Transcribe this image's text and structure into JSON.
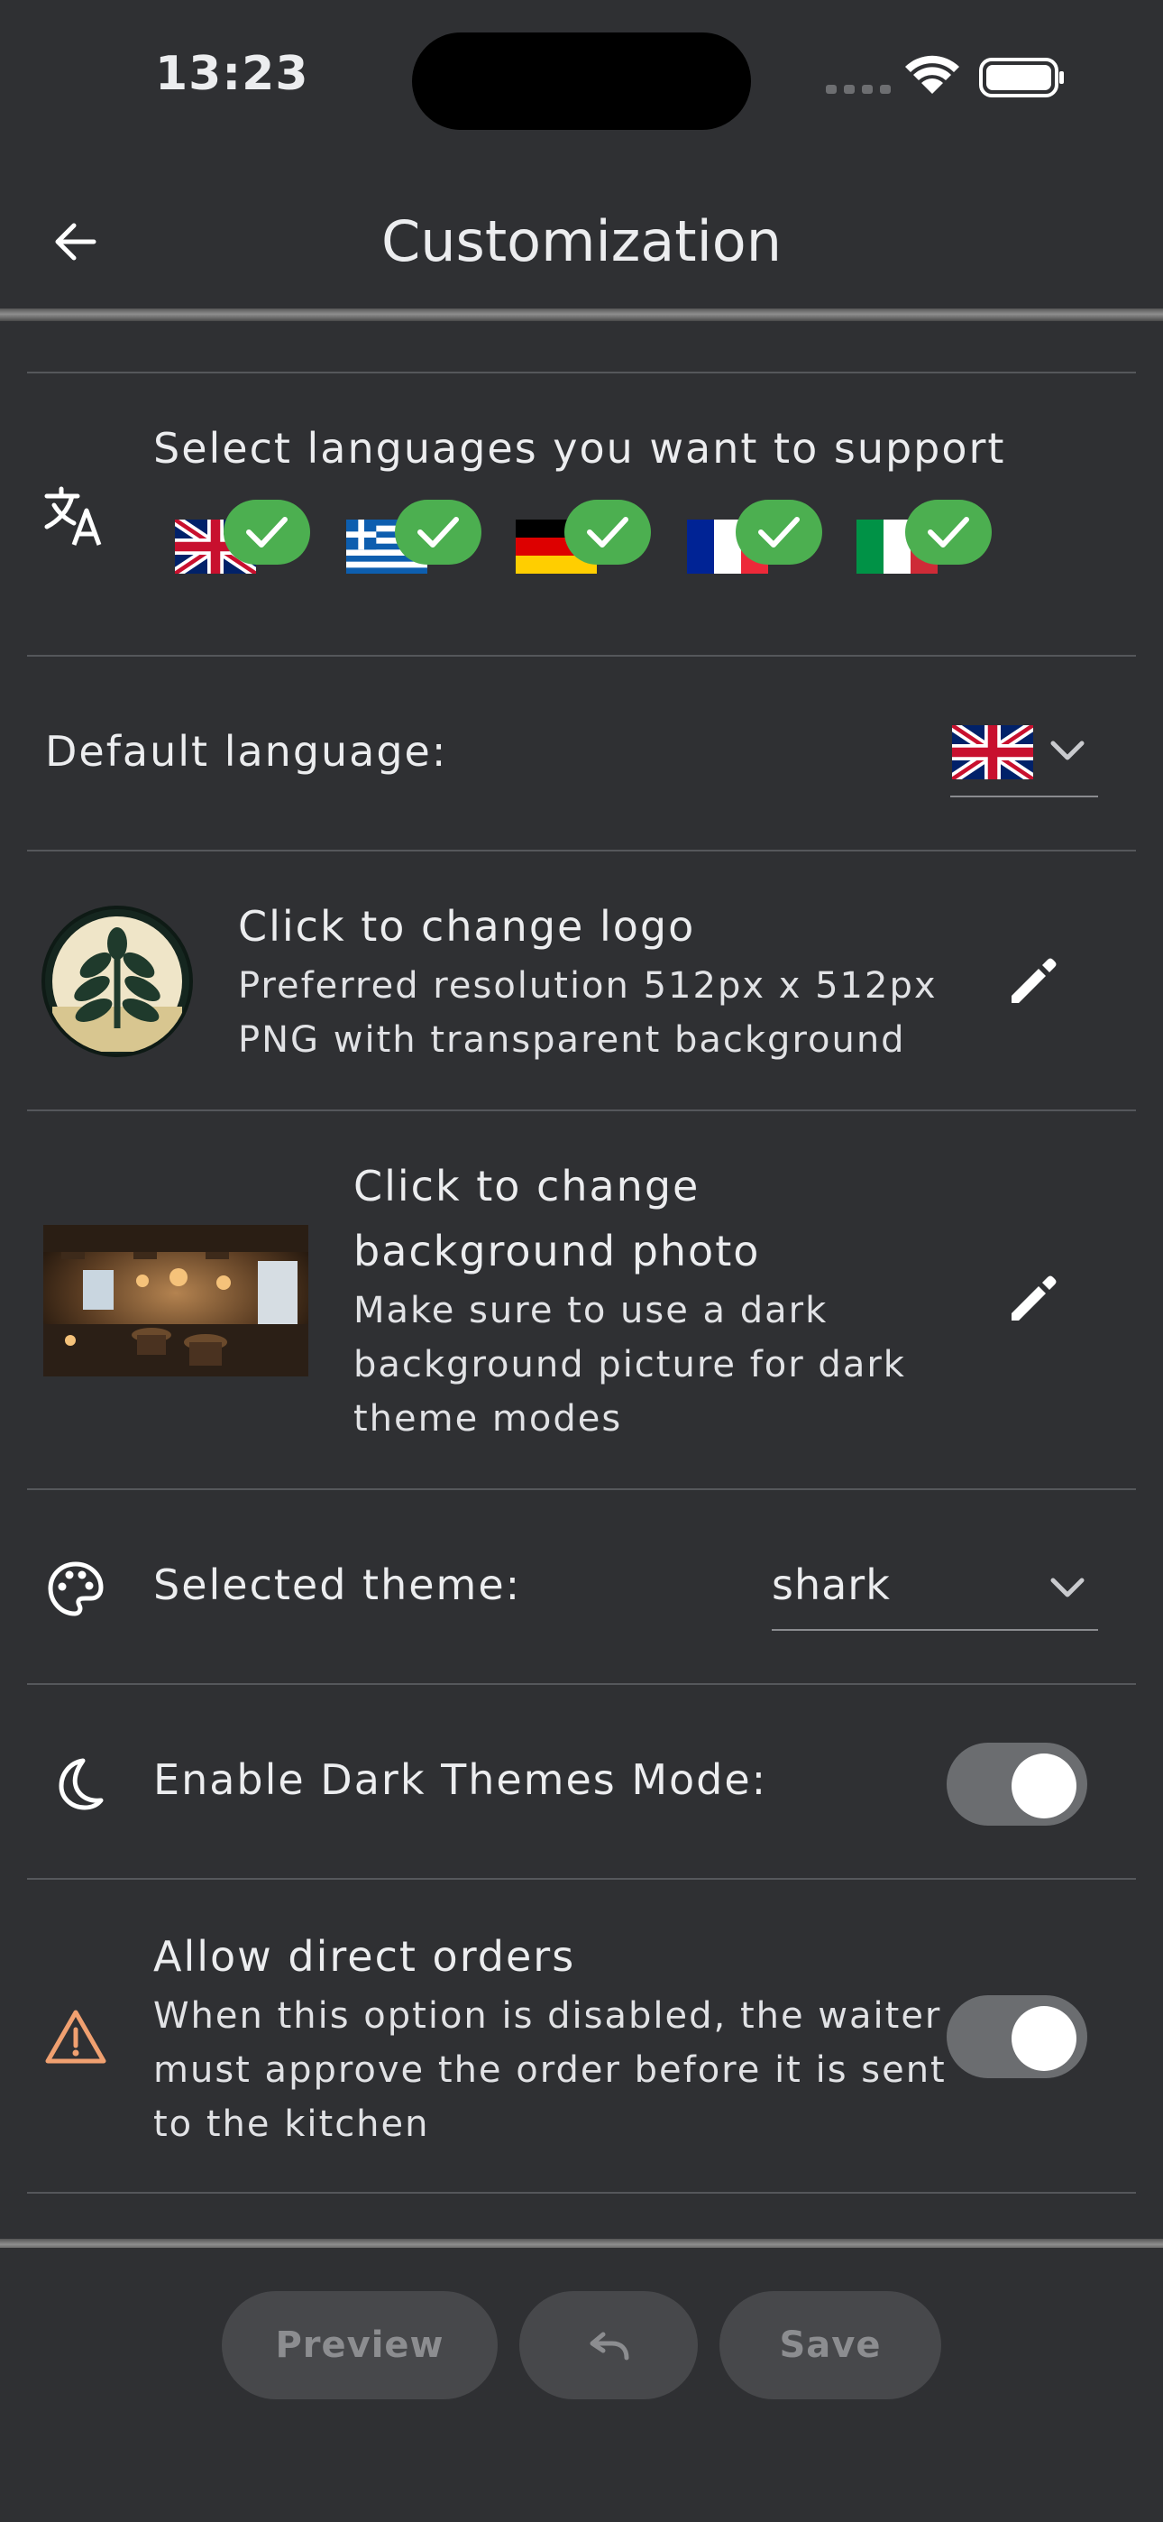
{
  "status_bar": {
    "time": "13:23"
  },
  "app_bar": {
    "title": "Customization"
  },
  "languages": {
    "label": "Select languages you want to support",
    "flags": [
      "uk-flag",
      "greece-flag",
      "germany-flag",
      "france-flag",
      "italy-flag"
    ]
  },
  "default_language": {
    "label": "Default language:",
    "selected": "uk-flag"
  },
  "logo": {
    "title": "Click to change logo",
    "line1": "Preferred resolution 512px x 512px",
    "line2": "PNG with transparent background"
  },
  "background": {
    "title_line1": "Click to change",
    "title_line2": "background photo",
    "desc_line1": "Make sure to use a dark",
    "desc_line2": "background picture for dark",
    "desc_line3": "theme modes"
  },
  "theme": {
    "label": "Selected theme:",
    "value": "shark"
  },
  "dark_mode": {
    "label": "Enable Dark Themes Mode:",
    "enabled": true
  },
  "direct_orders": {
    "title": "Allow direct orders",
    "desc_line1": "When this option is disabled, the waiter",
    "desc_line2": "must approve the order before it is sent",
    "desc_line3": "to the kitchen",
    "enabled": true
  },
  "actions": {
    "preview": "Preview",
    "save": "Save"
  },
  "colors": {
    "background": "#2f3033",
    "check_green": "#4caf50",
    "warning_orange": "#f0a070"
  }
}
